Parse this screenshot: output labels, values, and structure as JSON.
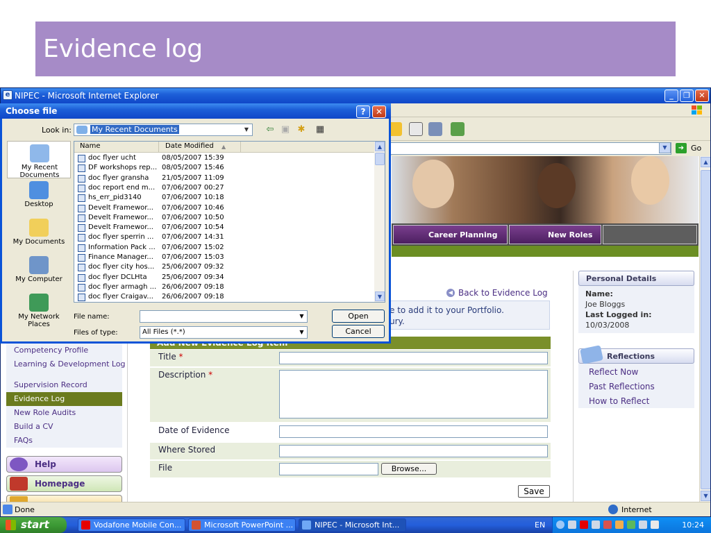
{
  "slide": {
    "title": "Evidence log"
  },
  "browser": {
    "title": "NIPEC - Microsoft Internet Explorer",
    "go_label": "Go",
    "status_text": "Done",
    "zone_text": "Internet"
  },
  "page": {
    "nav_tabs": [
      {
        "label": "Career Planning"
      },
      {
        "label": "New Roles"
      }
    ],
    "back_link": "Back to Evidence Log",
    "instruction_line1": "e to add it to your Portfolio.",
    "instruction_line2": "ury.",
    "form": {
      "header": "Add New Evidence Log Item",
      "title_label": "Title",
      "description_label": "Description",
      "required_mark": "*",
      "date_label": "Date of Evidence",
      "where_label": "Where Stored",
      "file_label": "File",
      "browse_label": "Browse...",
      "save_label": "Save"
    },
    "left_nav": [
      {
        "label": "Competency Profile",
        "active": false
      },
      {
        "label": "Learning & Development Log",
        "active": false
      },
      {
        "label": "Supervision Record",
        "active": false
      },
      {
        "label": "Evidence Log",
        "active": true
      },
      {
        "label": "New Role Audits",
        "active": false
      },
      {
        "label": "Build a CV",
        "active": false
      },
      {
        "label": "FAQs",
        "active": false
      }
    ],
    "side_buttons": {
      "help": "Help",
      "homepage": "Homepage"
    },
    "personal_details": {
      "header": "Personal Details",
      "name_label": "Name:",
      "name_value": "Joe Bloggs",
      "last_logged_label": "Last Logged in:",
      "last_logged_value": "10/03/2008"
    },
    "reflections": {
      "header": "Reflections",
      "links": [
        "Reflect Now",
        "Past Reflections",
        "How to Reflect"
      ]
    }
  },
  "dialog": {
    "title": "Choose file",
    "look_in_label": "Look in:",
    "look_in_value": "My Recent Documents",
    "places": [
      {
        "label": "My Recent Documents",
        "icon": "recent-documents-icon",
        "selected": true
      },
      {
        "label": "Desktop",
        "icon": "desktop-icon",
        "selected": false
      },
      {
        "label": "My Documents",
        "icon": "my-documents-icon",
        "selected": false
      },
      {
        "label": "My Computer",
        "icon": "my-computer-icon",
        "selected": false
      },
      {
        "label": "My Network Places",
        "icon": "network-places-icon",
        "selected": false
      }
    ],
    "columns": {
      "name": "Name",
      "date": "Date Modified"
    },
    "files": [
      {
        "name": "doc flyer ucht",
        "date": "08/05/2007 15:39"
      },
      {
        "name": "DF workshops rep...",
        "date": "08/05/2007 15:46"
      },
      {
        "name": "doc flyer gransha",
        "date": "21/05/2007 11:09"
      },
      {
        "name": "doc report end m...",
        "date": "07/06/2007 00:27"
      },
      {
        "name": "hs_err_pid3140",
        "date": "07/06/2007 10:18"
      },
      {
        "name": "Develt Framewor...",
        "date": "07/06/2007 10:46"
      },
      {
        "name": "Develt Framewor...",
        "date": "07/06/2007 10:50"
      },
      {
        "name": "Develt Framewor...",
        "date": "07/06/2007 10:54"
      },
      {
        "name": "doc flyer sperrin ...",
        "date": "07/06/2007 14:31"
      },
      {
        "name": "Information Pack ...",
        "date": "07/06/2007 15:02"
      },
      {
        "name": "Finance Manager...",
        "date": "07/06/2007 15:03"
      },
      {
        "name": "doc flyer city hos...",
        "date": "25/06/2007 09:32"
      },
      {
        "name": "doc flyer DCLHta",
        "date": "25/06/2007 09:34"
      },
      {
        "name": "doc flyer armagh ...",
        "date": "26/06/2007 09:18"
      },
      {
        "name": "doc flyer Craigav...",
        "date": "26/06/2007 09:18"
      }
    ],
    "file_name_label": "File name:",
    "file_name_value": "",
    "file_type_label": "Files of type:",
    "file_type_value": "All Files (*.*)",
    "open_label": "Open",
    "cancel_label": "Cancel"
  },
  "taskbar": {
    "start_label": "start",
    "tasks": [
      {
        "label": "Vodafone Mobile Con...",
        "active": false
      },
      {
        "label": "Microsoft PowerPoint ...",
        "active": false
      },
      {
        "label": "NIPEC - Microsoft Int...",
        "active": true
      }
    ],
    "language": "EN",
    "clock": "10:24"
  }
}
